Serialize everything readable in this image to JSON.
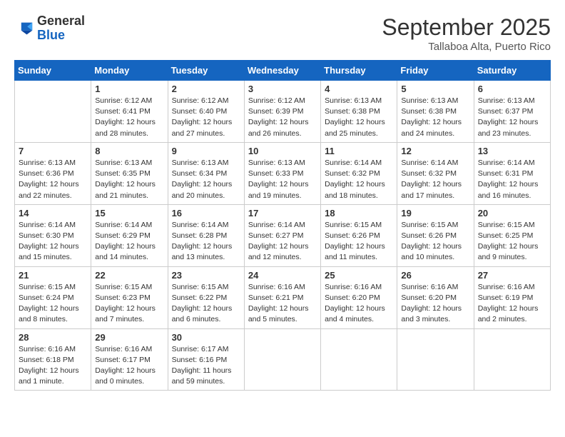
{
  "header": {
    "logo_line1": "General",
    "logo_line2": "Blue",
    "month": "September 2025",
    "location": "Tallaboa Alta, Puerto Rico"
  },
  "weekdays": [
    "Sunday",
    "Monday",
    "Tuesday",
    "Wednesday",
    "Thursday",
    "Friday",
    "Saturday"
  ],
  "weeks": [
    [
      {
        "day": "",
        "info": ""
      },
      {
        "day": "1",
        "info": "Sunrise: 6:12 AM\nSunset: 6:41 PM\nDaylight: 12 hours\nand 28 minutes."
      },
      {
        "day": "2",
        "info": "Sunrise: 6:12 AM\nSunset: 6:40 PM\nDaylight: 12 hours\nand 27 minutes."
      },
      {
        "day": "3",
        "info": "Sunrise: 6:12 AM\nSunset: 6:39 PM\nDaylight: 12 hours\nand 26 minutes."
      },
      {
        "day": "4",
        "info": "Sunrise: 6:13 AM\nSunset: 6:38 PM\nDaylight: 12 hours\nand 25 minutes."
      },
      {
        "day": "5",
        "info": "Sunrise: 6:13 AM\nSunset: 6:38 PM\nDaylight: 12 hours\nand 24 minutes."
      },
      {
        "day": "6",
        "info": "Sunrise: 6:13 AM\nSunset: 6:37 PM\nDaylight: 12 hours\nand 23 minutes."
      }
    ],
    [
      {
        "day": "7",
        "info": "Sunrise: 6:13 AM\nSunset: 6:36 PM\nDaylight: 12 hours\nand 22 minutes."
      },
      {
        "day": "8",
        "info": "Sunrise: 6:13 AM\nSunset: 6:35 PM\nDaylight: 12 hours\nand 21 minutes."
      },
      {
        "day": "9",
        "info": "Sunrise: 6:13 AM\nSunset: 6:34 PM\nDaylight: 12 hours\nand 20 minutes."
      },
      {
        "day": "10",
        "info": "Sunrise: 6:13 AM\nSunset: 6:33 PM\nDaylight: 12 hours\nand 19 minutes."
      },
      {
        "day": "11",
        "info": "Sunrise: 6:14 AM\nSunset: 6:32 PM\nDaylight: 12 hours\nand 18 minutes."
      },
      {
        "day": "12",
        "info": "Sunrise: 6:14 AM\nSunset: 6:32 PM\nDaylight: 12 hours\nand 17 minutes."
      },
      {
        "day": "13",
        "info": "Sunrise: 6:14 AM\nSunset: 6:31 PM\nDaylight: 12 hours\nand 16 minutes."
      }
    ],
    [
      {
        "day": "14",
        "info": "Sunrise: 6:14 AM\nSunset: 6:30 PM\nDaylight: 12 hours\nand 15 minutes."
      },
      {
        "day": "15",
        "info": "Sunrise: 6:14 AM\nSunset: 6:29 PM\nDaylight: 12 hours\nand 14 minutes."
      },
      {
        "day": "16",
        "info": "Sunrise: 6:14 AM\nSunset: 6:28 PM\nDaylight: 12 hours\nand 13 minutes."
      },
      {
        "day": "17",
        "info": "Sunrise: 6:14 AM\nSunset: 6:27 PM\nDaylight: 12 hours\nand 12 minutes."
      },
      {
        "day": "18",
        "info": "Sunrise: 6:15 AM\nSunset: 6:26 PM\nDaylight: 12 hours\nand 11 minutes."
      },
      {
        "day": "19",
        "info": "Sunrise: 6:15 AM\nSunset: 6:26 PM\nDaylight: 12 hours\nand 10 minutes."
      },
      {
        "day": "20",
        "info": "Sunrise: 6:15 AM\nSunset: 6:25 PM\nDaylight: 12 hours\nand 9 minutes."
      }
    ],
    [
      {
        "day": "21",
        "info": "Sunrise: 6:15 AM\nSunset: 6:24 PM\nDaylight: 12 hours\nand 8 minutes."
      },
      {
        "day": "22",
        "info": "Sunrise: 6:15 AM\nSunset: 6:23 PM\nDaylight: 12 hours\nand 7 minutes."
      },
      {
        "day": "23",
        "info": "Sunrise: 6:15 AM\nSunset: 6:22 PM\nDaylight: 12 hours\nand 6 minutes."
      },
      {
        "day": "24",
        "info": "Sunrise: 6:16 AM\nSunset: 6:21 PM\nDaylight: 12 hours\nand 5 minutes."
      },
      {
        "day": "25",
        "info": "Sunrise: 6:16 AM\nSunset: 6:20 PM\nDaylight: 12 hours\nand 4 minutes."
      },
      {
        "day": "26",
        "info": "Sunrise: 6:16 AM\nSunset: 6:20 PM\nDaylight: 12 hours\nand 3 minutes."
      },
      {
        "day": "27",
        "info": "Sunrise: 6:16 AM\nSunset: 6:19 PM\nDaylight: 12 hours\nand 2 minutes."
      }
    ],
    [
      {
        "day": "28",
        "info": "Sunrise: 6:16 AM\nSunset: 6:18 PM\nDaylight: 12 hours\nand 1 minute."
      },
      {
        "day": "29",
        "info": "Sunrise: 6:16 AM\nSunset: 6:17 PM\nDaylight: 12 hours\nand 0 minutes."
      },
      {
        "day": "30",
        "info": "Sunrise: 6:17 AM\nSunset: 6:16 PM\nDaylight: 11 hours\nand 59 minutes."
      },
      {
        "day": "",
        "info": ""
      },
      {
        "day": "",
        "info": ""
      },
      {
        "day": "",
        "info": ""
      },
      {
        "day": "",
        "info": ""
      }
    ]
  ]
}
